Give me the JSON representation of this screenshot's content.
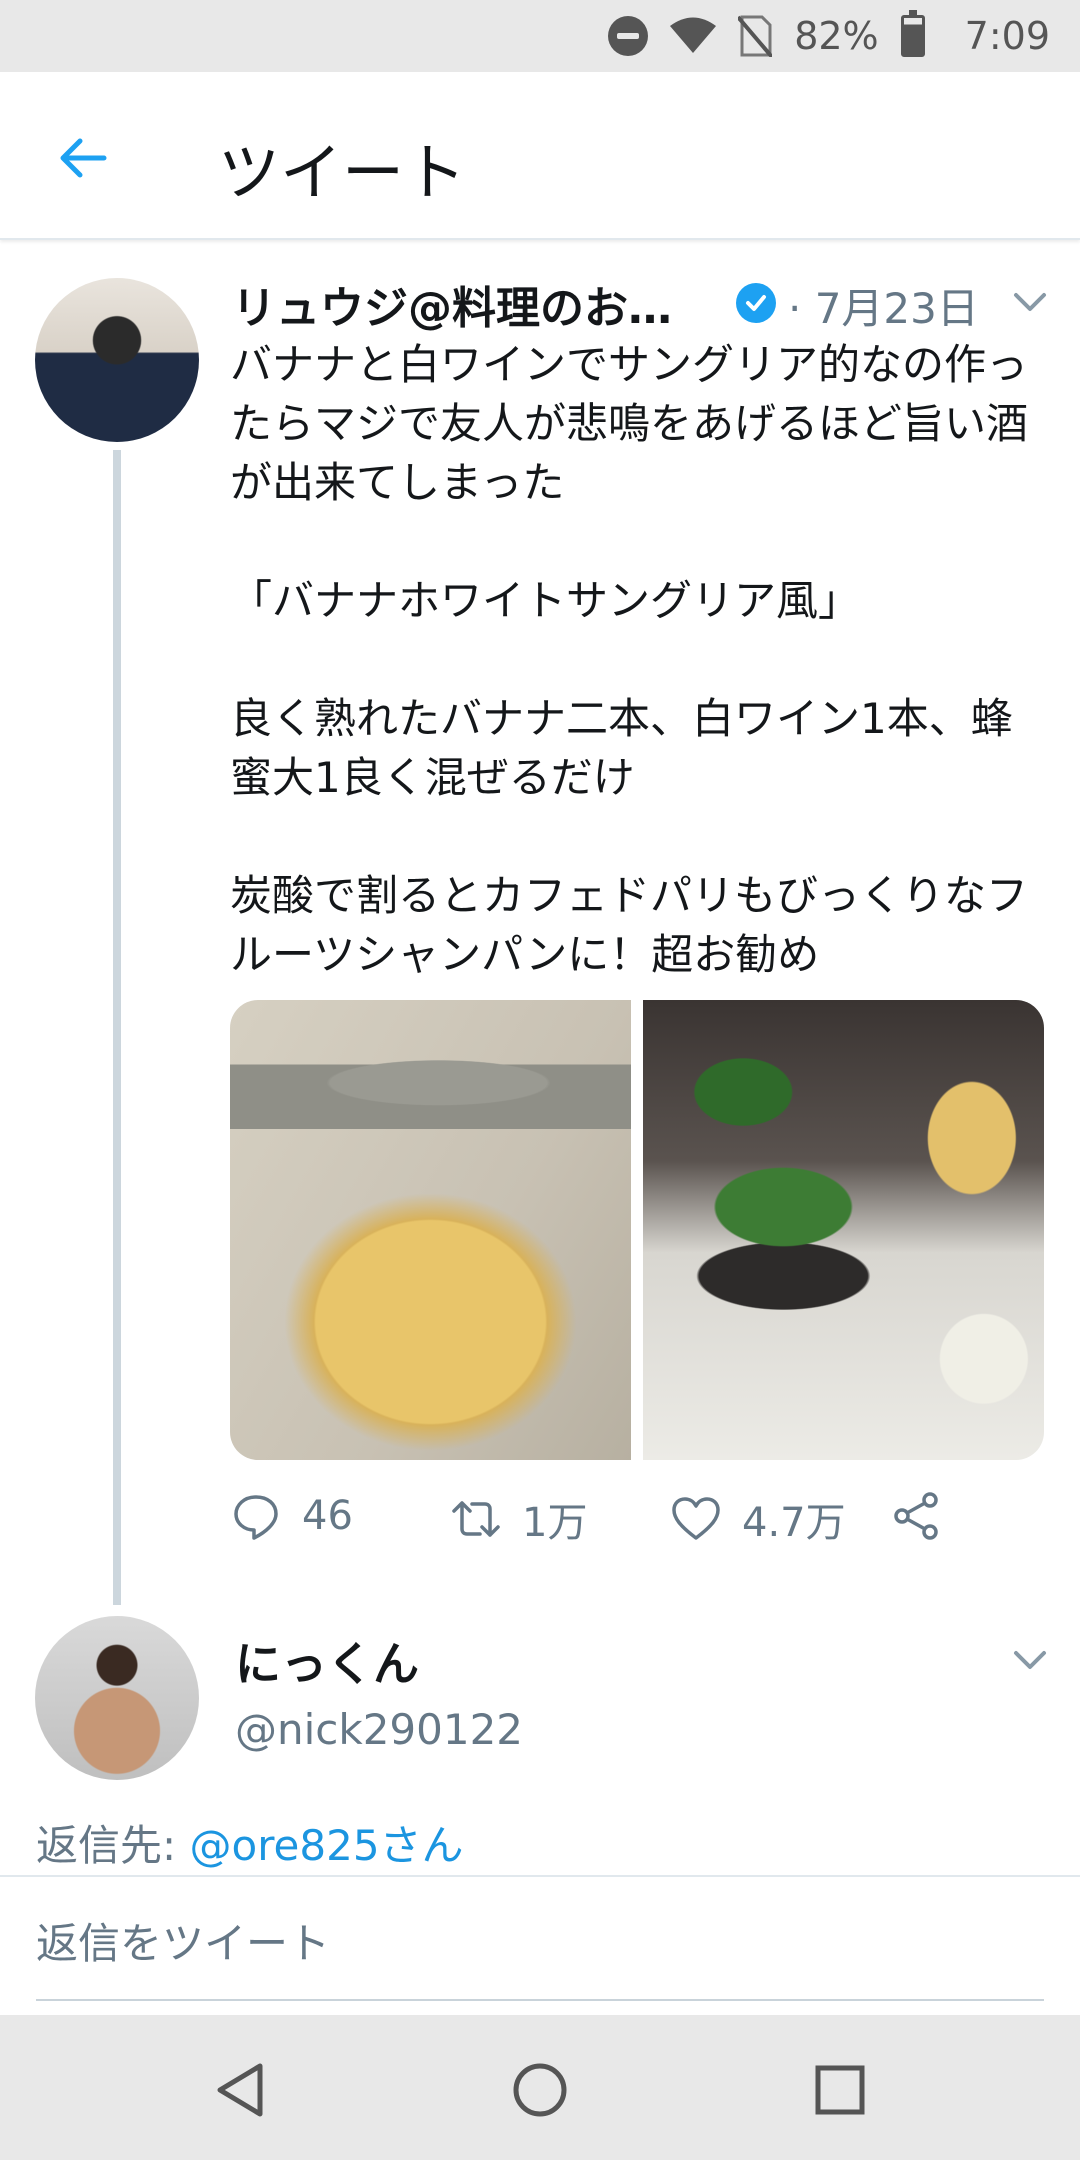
{
  "status_bar": {
    "battery": "82%",
    "time": "7:09",
    "icons": [
      "do-not-disturb-icon",
      "wifi-icon",
      "no-sim-icon",
      "battery-icon"
    ]
  },
  "app_bar": {
    "title": "ツイート",
    "back_icon": "arrow-left-icon"
  },
  "tweet": {
    "author_name": "リュウジ@料理のおに...",
    "verified": true,
    "date": "· 7月23日",
    "text_paragraphs": [
      "バナナと白ワインでサングリア的なの作ったらマジで友人が悲鳴をあげるほど旨い酒が出来てしまった",
      "「バナナホワイトサングリア風」",
      "良く熟れたバナナ二本、白ワイン1本、蜂蜜大1良く混ぜるだけ",
      "炭酸で割るとカフェドパリもびっくりなフルーツシャンパンに！超お勧め"
    ],
    "media": [
      "banana-jar-photo",
      "banana-jar-with-plant-photo"
    ],
    "actions": {
      "reply_count": "46",
      "retweet_count": "1万",
      "like_count": "4.7万"
    }
  },
  "reply_author": {
    "name": "にっくん",
    "handle": "@nick290122"
  },
  "reply_to": {
    "prefix": "返信先: ",
    "handle": "@ore825さん"
  },
  "compose": {
    "placeholder": "返信をツイート"
  },
  "colors": {
    "accent": "#1da1f2",
    "secondary_text": "#657786",
    "primary_text": "#14171a"
  }
}
